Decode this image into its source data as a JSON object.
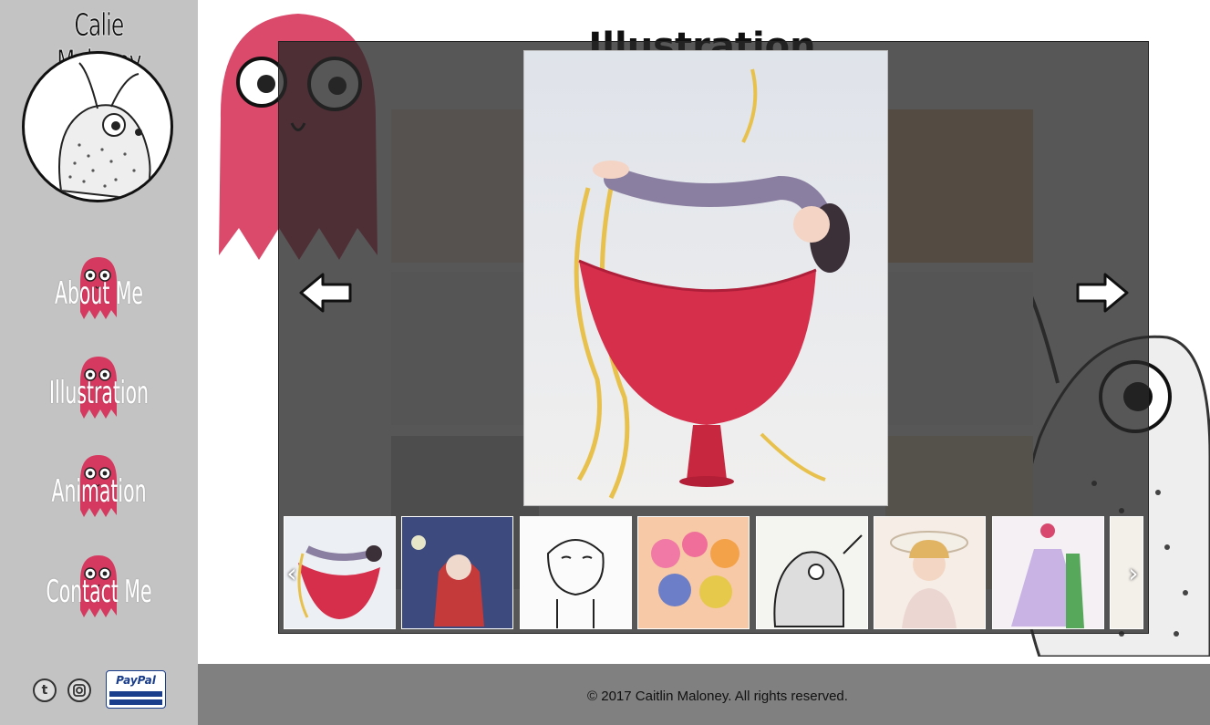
{
  "site": {
    "title": "Calie Maloney"
  },
  "nav": [
    {
      "label": "About Me"
    },
    {
      "label": "Illustration"
    },
    {
      "label": "Animation"
    },
    {
      "label": "Contact Me"
    }
  ],
  "social": {
    "tumblr": "t",
    "instagram": "instagram-icon",
    "paypal": "PayPal"
  },
  "page": {
    "heading": "Illustration"
  },
  "lightbox": {
    "main_image": "watercolor girl with long blonde hair in red bowl",
    "prev": "left-arrow",
    "next": "right-arrow",
    "thumbnails": [
      {
        "name": "girl in red bowl"
      },
      {
        "name": "red hood in blue forest"
      },
      {
        "name": "ink sketch boy"
      },
      {
        "name": "pink crowd"
      },
      {
        "name": "fuzzy moth creature"
      },
      {
        "name": "woman in hat"
      },
      {
        "name": "lavender dress lady"
      },
      {
        "name": "partial"
      }
    ]
  },
  "footer": {
    "copyright": "© 2017 Caitlin Maloney. All rights reserved."
  },
  "colors": {
    "sidebar": "#c3c3c3",
    "footer": "#808080",
    "ghost": "#d6395f",
    "overlay": "rgba(40,40,40,0.78)"
  }
}
